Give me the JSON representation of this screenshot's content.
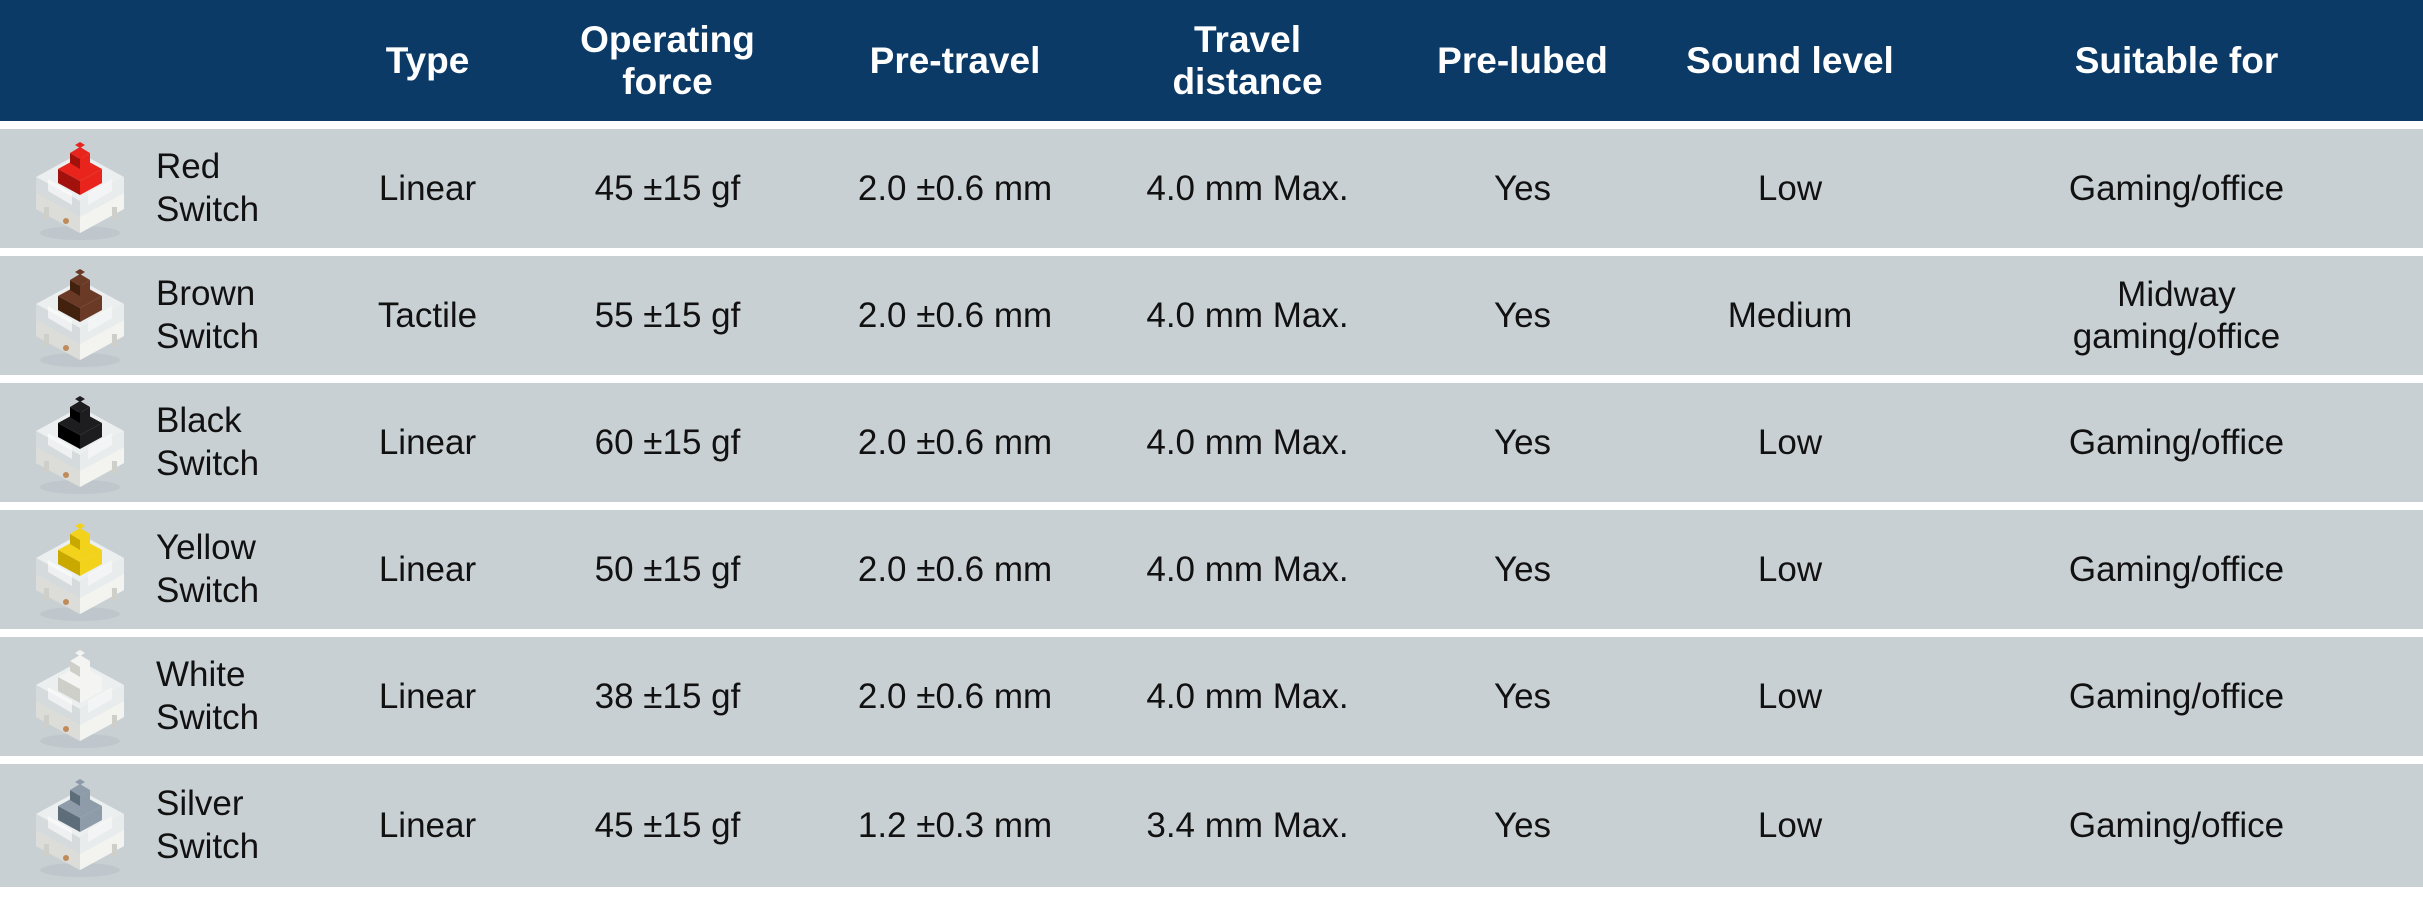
{
  "table": {
    "headers": [
      {
        "key": "switch",
        "label": ""
      },
      {
        "key": "type",
        "label": "Type"
      },
      {
        "key": "force",
        "label": "Operating\nforce"
      },
      {
        "key": "pretravel",
        "label": "Pre-travel"
      },
      {
        "key": "travel",
        "label": "Travel\ndistance"
      },
      {
        "key": "prelubed",
        "label": "Pre-lubed"
      },
      {
        "key": "sound",
        "label": "Sound level"
      },
      {
        "key": "suitable",
        "label": "Suitable for"
      }
    ],
    "rows": [
      {
        "name": "Red\nSwitch",
        "icon": "red-switch-icon",
        "stem_color": "#e8241d",
        "stem_shadow": "#a3110c",
        "type": "Linear",
        "force": "45 ±15 gf",
        "pretravel": "2.0 ±0.6 mm",
        "travel": "4.0 mm Max.",
        "prelubed": "Yes",
        "sound": "Low",
        "suitable": "Gaming/office"
      },
      {
        "name": "Brown\nSwitch",
        "icon": "brown-switch-icon",
        "stem_color": "#6a3a27",
        "stem_shadow": "#42210f",
        "type": "Tactile",
        "force": "55 ±15 gf",
        "pretravel": "2.0 ±0.6 mm",
        "travel": "4.0 mm Max.",
        "prelubed": "Yes",
        "sound": "Medium",
        "suitable": "Midway\ngaming/office"
      },
      {
        "name": "Black\nSwitch",
        "icon": "black-switch-icon",
        "stem_color": "#1d1d1f",
        "stem_shadow": "#000000",
        "type": "Linear",
        "force": "60 ±15 gf",
        "pretravel": "2.0 ±0.6 mm",
        "travel": "4.0 mm Max.",
        "prelubed": "Yes",
        "sound": "Low",
        "suitable": "Gaming/office"
      },
      {
        "name": "Yellow\nSwitch",
        "icon": "yellow-switch-icon",
        "stem_color": "#f2d21a",
        "stem_shadow": "#c9a800",
        "type": "Linear",
        "force": "50 ±15 gf",
        "pretravel": "2.0 ±0.6 mm",
        "travel": "4.0 mm Max.",
        "prelubed": "Yes",
        "sound": "Low",
        "suitable": "Gaming/office"
      },
      {
        "name": "White\nSwitch",
        "icon": "white-switch-icon",
        "stem_color": "#f4f4f2",
        "stem_shadow": "#cfcfca",
        "type": "Linear",
        "force": "38 ±15 gf",
        "pretravel": "2.0 ±0.6 mm",
        "travel": "4.0 mm Max.",
        "prelubed": "Yes",
        "sound": "Low",
        "suitable": "Gaming/office"
      },
      {
        "name": "Silver\nSwitch",
        "icon": "silver-switch-icon",
        "stem_color": "#8e9ba8",
        "stem_shadow": "#5e6d7a",
        "type": "Linear",
        "force": "45 ±15 gf",
        "pretravel": "1.2 ±0.3 mm",
        "travel": "3.4 mm Max.",
        "prelubed": "Yes",
        "sound": "Low",
        "suitable": "Gaming/office"
      }
    ]
  },
  "colors": {
    "header_bg": "#0b3a67",
    "header_text": "#ffffff",
    "row_bg": "#c9d0d4",
    "row_separator": "#ffffff",
    "body_text": "#111111"
  }
}
